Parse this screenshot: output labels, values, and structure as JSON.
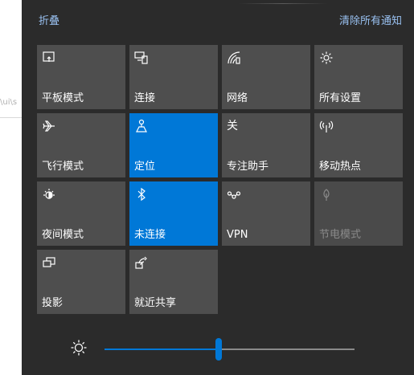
{
  "header": {
    "collapse_label": "折叠",
    "clear_all_label": "清除所有通知"
  },
  "background_fragment": "\\ui\\s",
  "tiles": [
    {
      "label": "平板模式",
      "icon": "tablet-mode-icon",
      "state": "off"
    },
    {
      "label": "连接",
      "icon": "connect-icon",
      "state": "off"
    },
    {
      "label": "网络",
      "icon": "network-icon",
      "state": "off"
    },
    {
      "label": "所有设置",
      "icon": "gear-icon",
      "state": "off"
    },
    {
      "label": "飞行模式",
      "icon": "airplane-icon",
      "state": "off"
    },
    {
      "label": "定位",
      "icon": "location-icon",
      "state": "on"
    },
    {
      "label": "专注助手",
      "icon": "focus-assist-icon",
      "state": "off",
      "icon_text": "关"
    },
    {
      "label": "移动热点",
      "icon": "hotspot-icon",
      "state": "off"
    },
    {
      "label": "夜间模式",
      "icon": "night-light-icon",
      "state": "off"
    },
    {
      "label": "未连接",
      "icon": "bluetooth-icon",
      "state": "on"
    },
    {
      "label": "VPN",
      "icon": "vpn-icon",
      "state": "off"
    },
    {
      "label": "节电模式",
      "icon": "battery-saver-icon",
      "state": "disabled"
    },
    {
      "label": "投影",
      "icon": "project-icon",
      "state": "off"
    },
    {
      "label": "就近共享",
      "icon": "nearby-share-icon",
      "state": "off"
    }
  ],
  "brightness": {
    "icon": "sun-icon",
    "level_fraction": 0.46
  },
  "colors": {
    "panel_bg": "#2b2b2b",
    "tile_bg": "#4e4e4e",
    "accent": "#0078d7",
    "link": "#99c1f1",
    "track_off": "#8a8a8a"
  }
}
